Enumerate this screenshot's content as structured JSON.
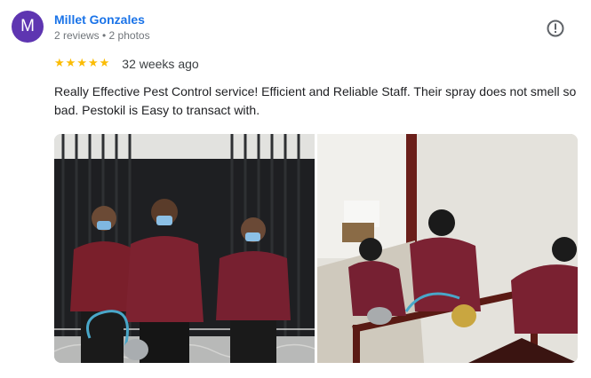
{
  "reviewer": {
    "initial": "M",
    "name": "Millet Gonzales",
    "meta": "2 reviews • 2 photos",
    "avatar_color": "#5e35b1"
  },
  "rating": {
    "stars": 5,
    "time": "32 weeks ago",
    "star_color": "#fbbc04"
  },
  "review": {
    "text": "Really Effective Pest Control service! Efficient and Reliable Staff. Their spray does not smell so bad. Pestokil is Easy to transact with."
  },
  "icons": {
    "report": "report-flag-icon",
    "star": "star-icon"
  },
  "photos": [
    {
      "name": "photo-technicians-gate"
    },
    {
      "name": "photo-technicians-spraying"
    }
  ]
}
